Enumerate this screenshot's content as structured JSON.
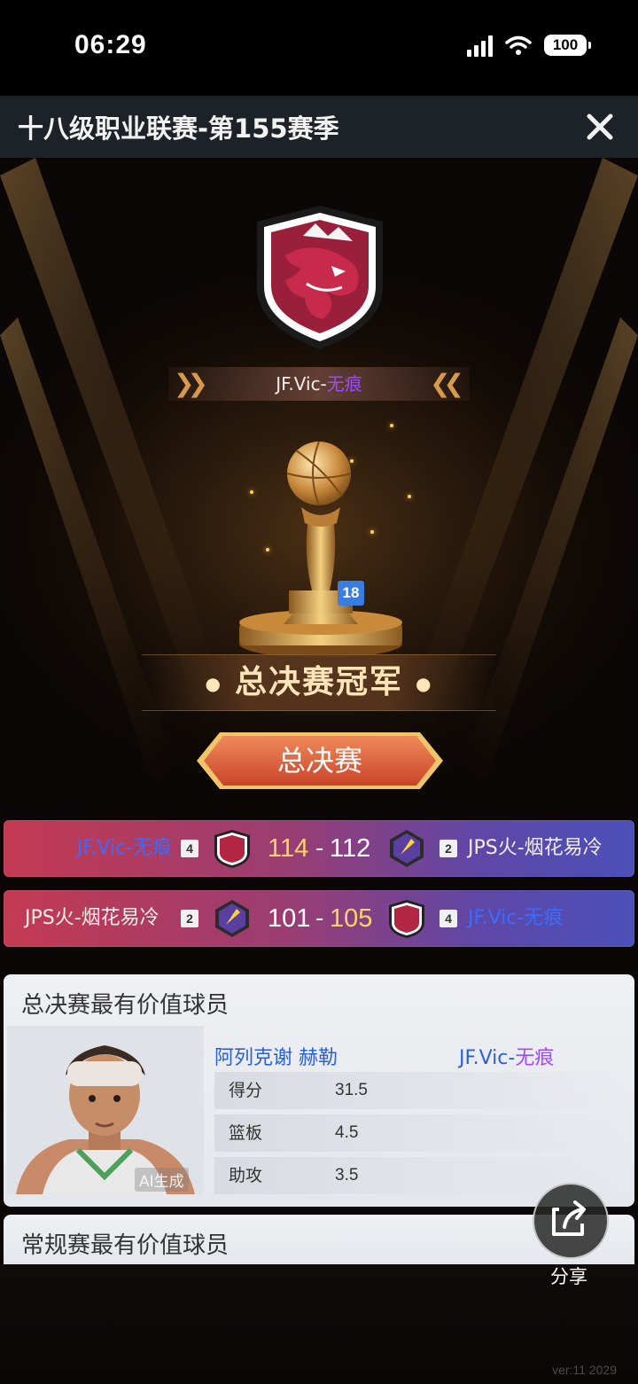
{
  "status_bar": {
    "time": "06:29",
    "battery": "100"
  },
  "header": {
    "title": "十八级职业联赛-第155赛季",
    "close_icon": "close-icon"
  },
  "champion": {
    "team_prefix": "JF.Vic-",
    "team_suffix": "无痕",
    "trophy_level": "18",
    "title": "总决赛冠军"
  },
  "finals_tab": {
    "label": "总决赛"
  },
  "matches": [
    {
      "left_team": "JF.Vic-无痕",
      "left_seed": "4",
      "left_score": "114",
      "sep": "-",
      "right_score": "112",
      "right_seed": "2",
      "right_team": "JPS火-烟花易冷"
    },
    {
      "left_team": "JPS火-烟花易冷",
      "left_seed": "2",
      "left_score": "101",
      "sep": "-",
      "right_score": "105",
      "right_seed": "4",
      "right_team": "JF.Vic-无痕"
    }
  ],
  "finals_mvp": {
    "title": "总决赛最有价值球员",
    "player_name": "阿列克谢 赫勒",
    "team_prefix": "JF.Vic-",
    "team_suffix": "无痕",
    "ai_tag": "AI生成",
    "stats": [
      {
        "label": "得分",
        "value": "31.5"
      },
      {
        "label": "篮板",
        "value": "4.5"
      },
      {
        "label": "助攻",
        "value": "3.5"
      }
    ]
  },
  "regular_mvp": {
    "title": "常规赛最有价值球员"
  },
  "share": {
    "label": "分享"
  },
  "footer": {
    "version": "ver:11  2029"
  },
  "colors": {
    "accent_gold": "#ffd36a",
    "team_purple": "#9b4bff",
    "team_blue": "#3a6cff",
    "row_gradient_left": "#c33a52",
    "row_gradient_right": "#4b50b8"
  }
}
